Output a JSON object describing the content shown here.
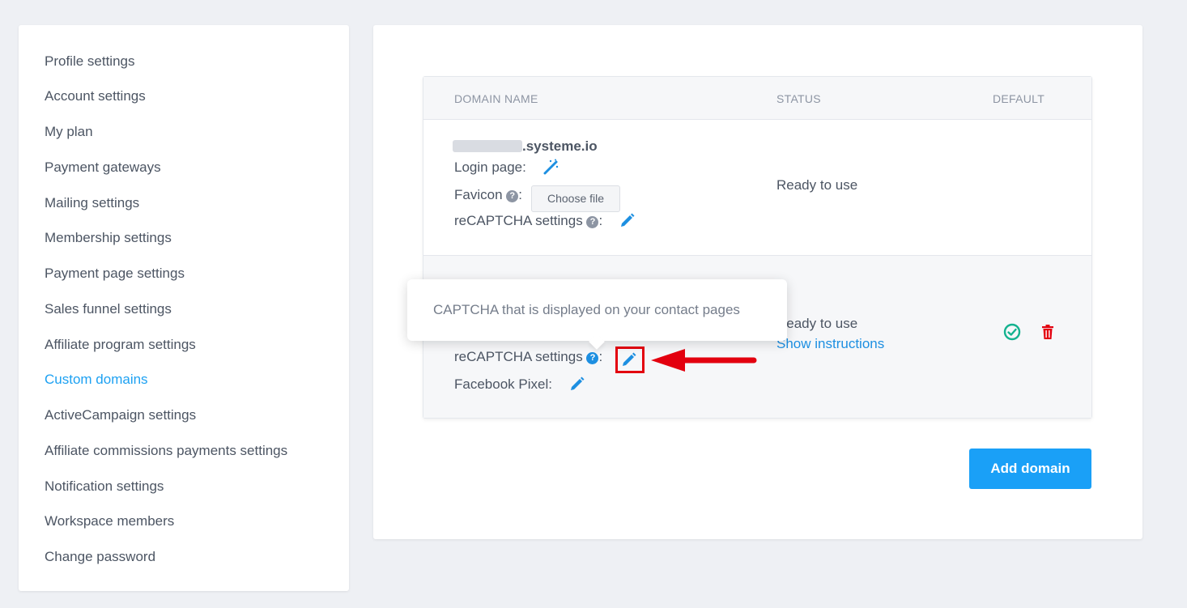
{
  "sidebar": {
    "items": [
      {
        "label": "Profile settings"
      },
      {
        "label": "Account settings"
      },
      {
        "label": "My plan"
      },
      {
        "label": "Payment gateways"
      },
      {
        "label": "Mailing settings"
      },
      {
        "label": "Membership settings"
      },
      {
        "label": "Payment page settings"
      },
      {
        "label": "Sales funnel settings"
      },
      {
        "label": "Affiliate program settings"
      },
      {
        "label": "Custom domains",
        "active": true
      },
      {
        "label": "ActiveCampaign settings"
      },
      {
        "label": "Affiliate commissions payments settings"
      },
      {
        "label": "Notification settings"
      },
      {
        "label": "Workspace members"
      },
      {
        "label": "Change password"
      }
    ]
  },
  "table": {
    "headers": {
      "domain": "DOMAIN NAME",
      "status": "STATUS",
      "default": "DEFAULT"
    },
    "rows": [
      {
        "domain_suffix": ".systeme.io",
        "login_page_label": "Login page:",
        "favicon_label": "Favicon",
        "favicon_colon": ":",
        "choose_file_label": "Choose file",
        "recaptcha_label": "reCAPTCHA settings",
        "recaptcha_colon": ":",
        "status": "Ready to use"
      },
      {
        "recaptcha_label": "reCAPTCHA settings",
        "recaptcha_colon": ":",
        "facebook_pixel_label": "Facebook Pixel:",
        "status": "Ready to use",
        "show_instructions": "Show instructions"
      }
    ]
  },
  "tooltip": {
    "text": "CAPTCHA that is displayed on your contact pages"
  },
  "add_domain_label": "Add domain",
  "colors": {
    "accent": "#1da1f2",
    "button": "#1aa0f7",
    "default_check": "#14b28f",
    "delete": "#e3000f",
    "highlight": "#e3000f"
  }
}
